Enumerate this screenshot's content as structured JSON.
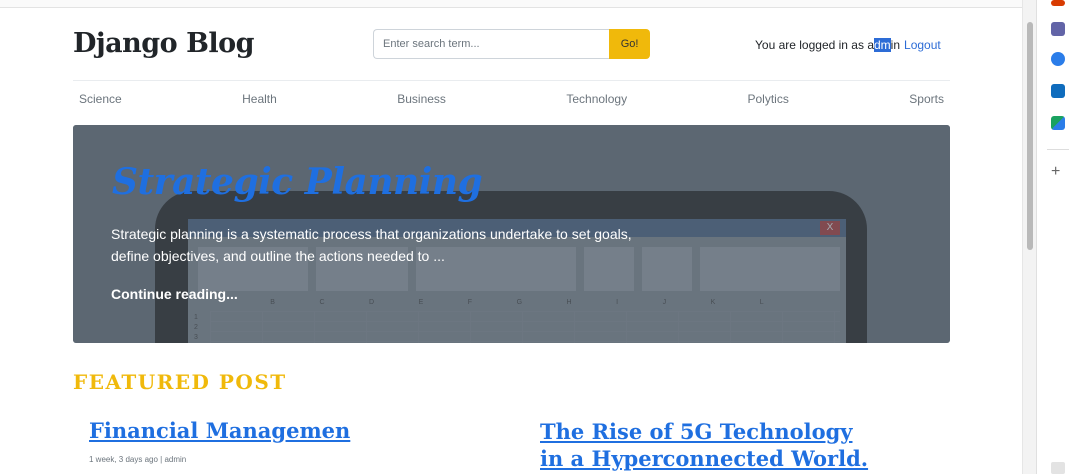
{
  "header": {
    "brand": "Django Blog",
    "search_placeholder": "Enter search term...",
    "search_button": "Go!",
    "login_prefix": "You are logged in as ",
    "login_user_pre": "a",
    "login_user_highlight": "dm",
    "login_user_post": "in",
    "logout_label": "Logout"
  },
  "nav": {
    "items": [
      {
        "label": "Science"
      },
      {
        "label": "Health"
      },
      {
        "label": "Business"
      },
      {
        "label": "Technology"
      },
      {
        "label": "Polytics"
      },
      {
        "label": "Sports"
      }
    ]
  },
  "hero": {
    "title": "Strategic Planning",
    "excerpt": "Strategic planning is a systematic process that organizations undertake to set goals, define objectives, and outline the actions needed to ...",
    "link": "Continue reading...",
    "image_close": "X",
    "image_columns": [
      "B",
      "C",
      "D",
      "E",
      "F",
      "G",
      "H",
      "I",
      "J",
      "K",
      "L"
    ],
    "image_rows": [
      "1",
      "2",
      "3"
    ]
  },
  "featured": {
    "heading": "FEATURED POST",
    "posts": [
      {
        "title": "Financial Managemen",
        "meta": "1 week, 3 days ago | admin"
      },
      {
        "title": "The Rise of 5G Technology in a Hyperconnected World."
      }
    ]
  },
  "colors": {
    "accent": "#f0b90b",
    "link": "#1f6fe0",
    "hero_bg": "#5f6b77"
  },
  "sidebar_icons": [
    "office-icon",
    "teams-icon",
    "copilot-icon",
    "outlook-icon",
    "shopping-icon",
    "add-icon"
  ]
}
